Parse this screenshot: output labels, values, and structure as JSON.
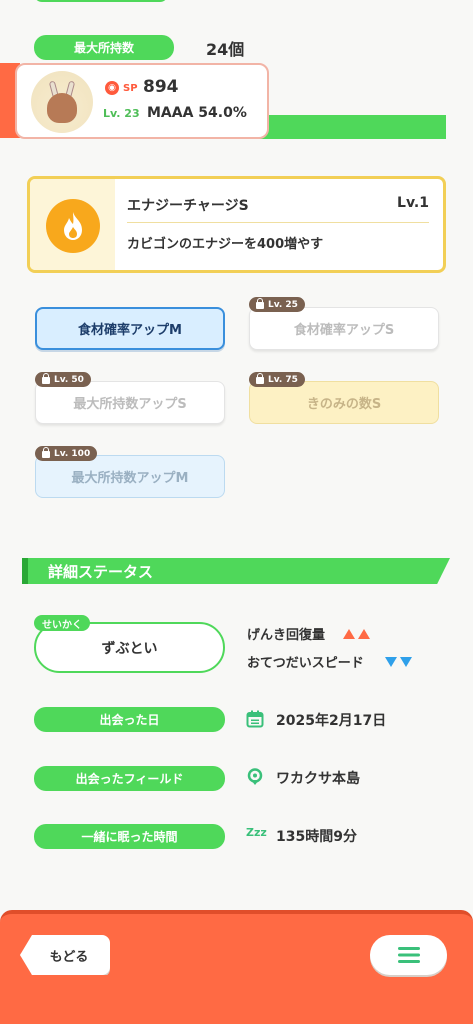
{
  "inventory": {
    "label": "最大所持数",
    "value": "24個"
  },
  "pokemon": {
    "sp_label": "SP",
    "sp_value": "894",
    "level": "Lv. 23",
    "main_stat": "MAAA 54.0%"
  },
  "main_skill": {
    "name": "エナジーチャージS",
    "level": "Lv.1",
    "description": "カビゴンのエナジーを400増やす"
  },
  "sub_skills": [
    {
      "label": "食材確率アップM",
      "lock": ""
    },
    {
      "label": "食材確率アップS",
      "lock": "Lv. 25"
    },
    {
      "label": "最大所持数アップS",
      "lock": "Lv. 50"
    },
    {
      "label": "きのみの数S",
      "lock": "Lv. 75"
    },
    {
      "label": "最大所持数アップM",
      "lock": "Lv. 100"
    }
  ],
  "details": {
    "section_title": "詳細ステータス",
    "nature_tag": "せいかく",
    "nature": "ずぶとい",
    "up_effect": "げんき回復量",
    "down_effect": "おてつだいスピード",
    "met_date_label": "出会った日",
    "met_date": "2025年2月17日",
    "met_field_label": "出会ったフィールド",
    "met_field": "ワカクサ本島",
    "sleep_time_label": "一緒に眠った時間",
    "sleep_time": "135時間9分",
    "sleep_icon_text": "Zzz"
  },
  "footer": {
    "back_label": "もどる"
  },
  "colors": {
    "accent_green": "#4fd85a",
    "orange": "#ff6a44",
    "skill_gold": "#f2cf56",
    "active_blue": "#3a8fdc"
  },
  "icons": [
    "pokeball-icon",
    "flame-icon",
    "lock-icon",
    "calendar-icon",
    "location-pin-icon",
    "sleep-icon",
    "hamburger-menu-icon"
  ]
}
